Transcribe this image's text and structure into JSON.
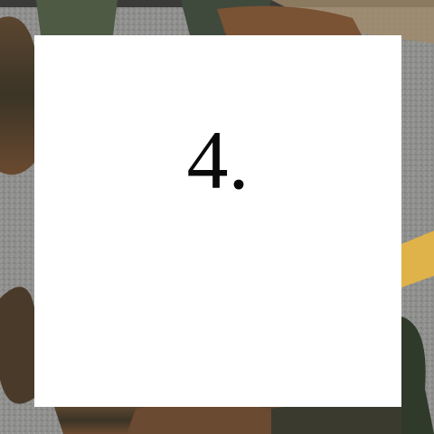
{
  "card": {
    "step_label": "4."
  },
  "background": {
    "description_colors": {
      "road": "#8f8f8d",
      "lane_line": "#e0b24a",
      "feathers_dark": "#3a3528",
      "feathers_brown": "#7a5234",
      "dirt": "#a08a6a"
    }
  }
}
